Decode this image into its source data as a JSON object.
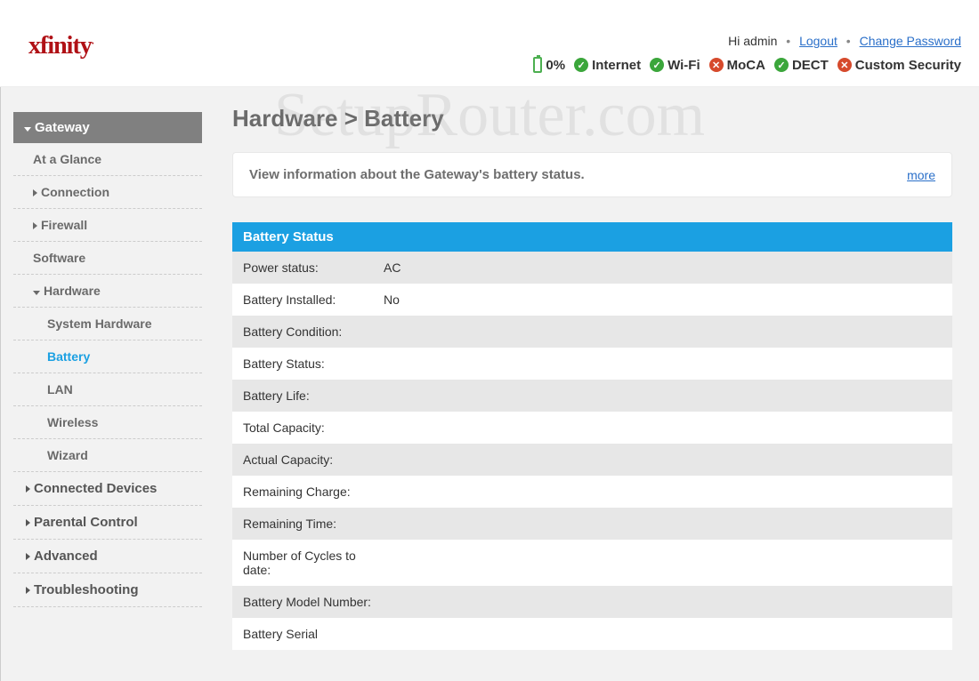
{
  "header": {
    "logo": "xfinity",
    "greeting": "Hi admin",
    "logout": "Logout",
    "change_password": "Change Password",
    "battery_pct": "0%",
    "status": [
      {
        "ok": true,
        "label": "Internet"
      },
      {
        "ok": true,
        "label": "Wi-Fi"
      },
      {
        "ok": false,
        "label": "MoCA"
      },
      {
        "ok": true,
        "label": "DECT"
      },
      {
        "ok": false,
        "label": "Custom Security"
      }
    ]
  },
  "watermark": "SetupRouter.com",
  "sidebar": {
    "gateway": "Gateway",
    "items": {
      "at_a_glance": "At a Glance",
      "connection": "Connection",
      "firewall": "Firewall",
      "software": "Software",
      "hardware": "Hardware",
      "system_hardware": "System Hardware",
      "battery": "Battery",
      "lan": "LAN",
      "wireless": "Wireless",
      "wizard": "Wizard",
      "connected_devices": "Connected Devices",
      "parental_control": "Parental Control",
      "advanced": "Advanced",
      "troubleshooting": "Troubleshooting"
    }
  },
  "main": {
    "breadcrumb": "Hardware > Battery",
    "info_text": "View information about the Gateway's battery status.",
    "more": "more",
    "panel_title": "Battery Status",
    "rows": [
      {
        "label": "Power status:",
        "value": "AC"
      },
      {
        "label": "Battery Installed:",
        "value": "No"
      },
      {
        "label": "Battery Condition:",
        "value": ""
      },
      {
        "label": "Battery Status:",
        "value": ""
      },
      {
        "label": "Battery Life:",
        "value": ""
      },
      {
        "label": "Total Capacity:",
        "value": ""
      },
      {
        "label": "Actual Capacity:",
        "value": ""
      },
      {
        "label": "Remaining Charge:",
        "value": ""
      },
      {
        "label": "Remaining Time:",
        "value": ""
      },
      {
        "label": "Number of Cycles to date:",
        "value": ""
      },
      {
        "label": "Battery Model Number:",
        "value": ""
      },
      {
        "label": "Battery Serial",
        "value": ""
      }
    ]
  }
}
